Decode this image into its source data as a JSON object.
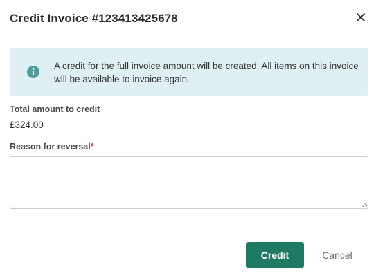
{
  "dialog": {
    "title": "Credit Invoice #123413425678",
    "close_icon": "close-icon"
  },
  "info_banner": {
    "icon": "info-icon",
    "message": "A credit for the full invoice amount will be created. All items on this invoice will be available to invoice again."
  },
  "total": {
    "label": "Total amount to credit",
    "value": "£324.00"
  },
  "reason": {
    "label": "Reason for reversal",
    "required_mark": "*",
    "value": "",
    "placeholder": ""
  },
  "actions": {
    "credit_label": "Credit",
    "cancel_label": "Cancel"
  },
  "colors": {
    "primary": "#1f7a63",
    "banner_bg": "#dfeff2",
    "info_icon": "#4a9d9c",
    "required": "#c62828"
  }
}
